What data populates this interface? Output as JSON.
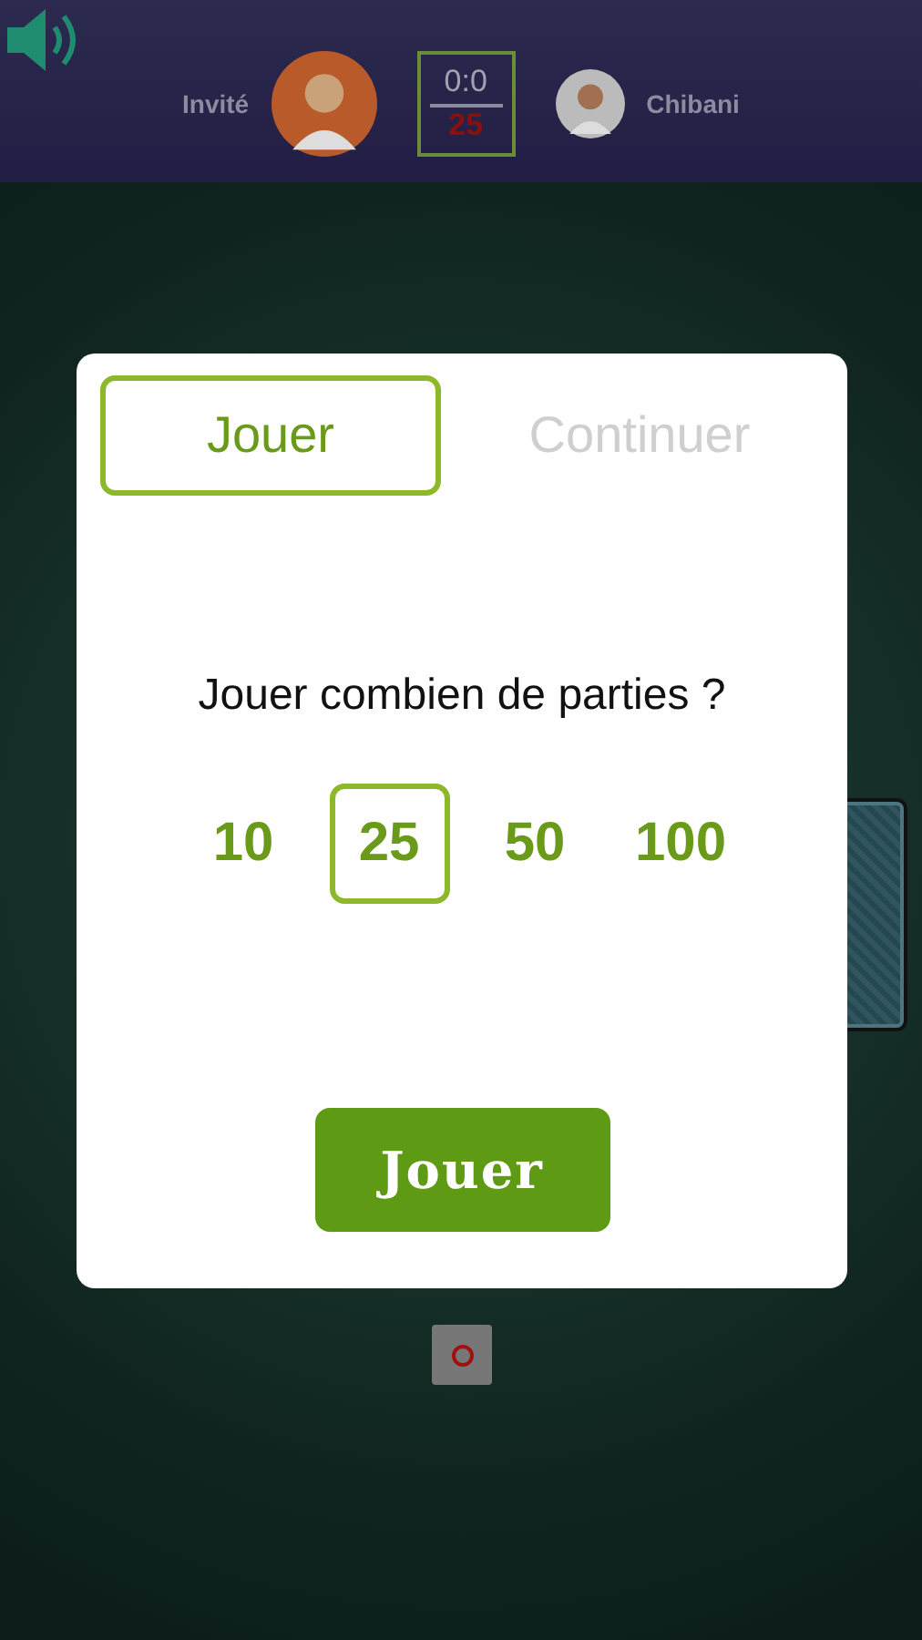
{
  "header": {
    "players": [
      {
        "name": "Invité"
      },
      {
        "name": "Chibani"
      }
    ],
    "score": {
      "result": "0:0",
      "target": "25"
    }
  },
  "dialog": {
    "tabs": [
      {
        "label": "Jouer",
        "selected": true
      },
      {
        "label": "Continuer",
        "selected": false
      }
    ],
    "question": "Jouer combien de parties ?",
    "options": [
      {
        "label": "10",
        "selected": false
      },
      {
        "label": "25",
        "selected": true
      },
      {
        "label": "50",
        "selected": false
      },
      {
        "label": "100",
        "selected": false
      }
    ],
    "button": "Jouer"
  }
}
